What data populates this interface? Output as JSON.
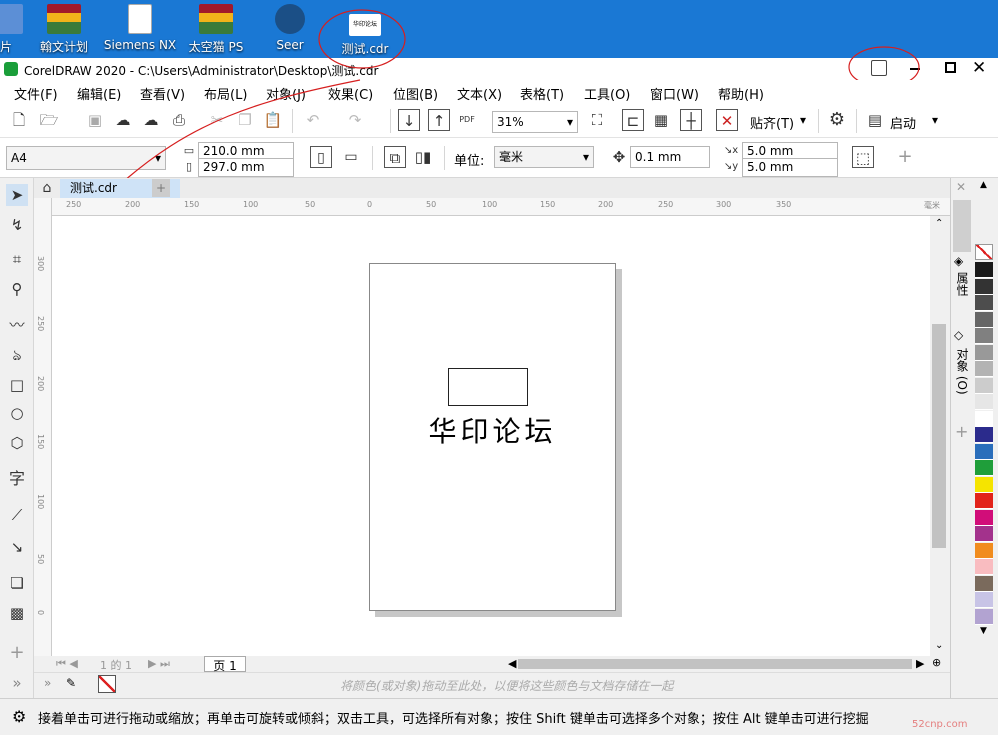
{
  "desktop": {
    "icons": [
      {
        "label": "片"
      },
      {
        "label": "翰文计划"
      },
      {
        "label": "Siemens NX"
      },
      {
        "label": "太空猫 PS"
      },
      {
        "label": "Seer"
      },
      {
        "label": "测试.cdr"
      }
    ],
    "thumb_text": "华印论坛"
  },
  "window": {
    "title": "CorelDRAW 2020 - C:\\Users\\Administrator\\Desktop\\测试.cdr"
  },
  "menu": [
    "文件(F)",
    "编辑(E)",
    "查看(V)",
    "布局(L)",
    "对象(J)",
    "效果(C)",
    "位图(B)",
    "文本(X)",
    "表格(T)",
    "工具(O)",
    "窗口(W)",
    "帮助(H)"
  ],
  "toolbar1": {
    "zoom": "31%",
    "snap": "贴齐(T)",
    "launch": "启动"
  },
  "toolbar2": {
    "page_size": "A4",
    "width": "210.0 mm",
    "height": "297.0 mm",
    "unit_label": "单位:",
    "unit": "毫米",
    "nudge": "0.1 mm",
    "dup_x": "5.0 mm",
    "dup_y": "5.0 mm"
  },
  "doc": {
    "tab": "测试.cdr",
    "page_text": "华印论坛",
    "page_tab": "页 1",
    "page_nav": "1 的 1"
  },
  "ruler_h": [
    "250",
    "200",
    "150",
    "100",
    "50",
    "0",
    "50",
    "100",
    "150",
    "200",
    "250",
    "300",
    "350"
  ],
  "ruler_h_unit": "毫米",
  "ruler_v": [
    "300",
    "250",
    "200",
    "150",
    "100",
    "50",
    "0"
  ],
  "dock": {
    "props": "属性",
    "objects": "对象 (O)"
  },
  "colorbar_hint": "将颜色(或对象)拖动至此处，以便将这些颜色与文档存储在一起",
  "status": "接着单击可进行拖动或缩放；再单击可旋转或倾斜；双击工具，可选择所有对象；按住 Shift 键单击可选择多个对象；按住 Alt 键单击可进行挖掘",
  "watermark": "52cnp.com",
  "palette": [
    "#ffffff",
    "#1a1a1a",
    "#333333",
    "#4d4d4d",
    "#666666",
    "#808080",
    "#999999",
    "#b3b3b3",
    "#cccccc",
    "#e6e6e6",
    "#ffffff",
    "#2b2b8c",
    "#2a6ebb",
    "#1f9e3a",
    "#f5e400",
    "#e2231a",
    "#d10d79",
    "#a3328c",
    "#f18c1e",
    "#f9bcc0",
    "#7a6a5c",
    "#c8c4e6",
    "#b2a3d1"
  ]
}
